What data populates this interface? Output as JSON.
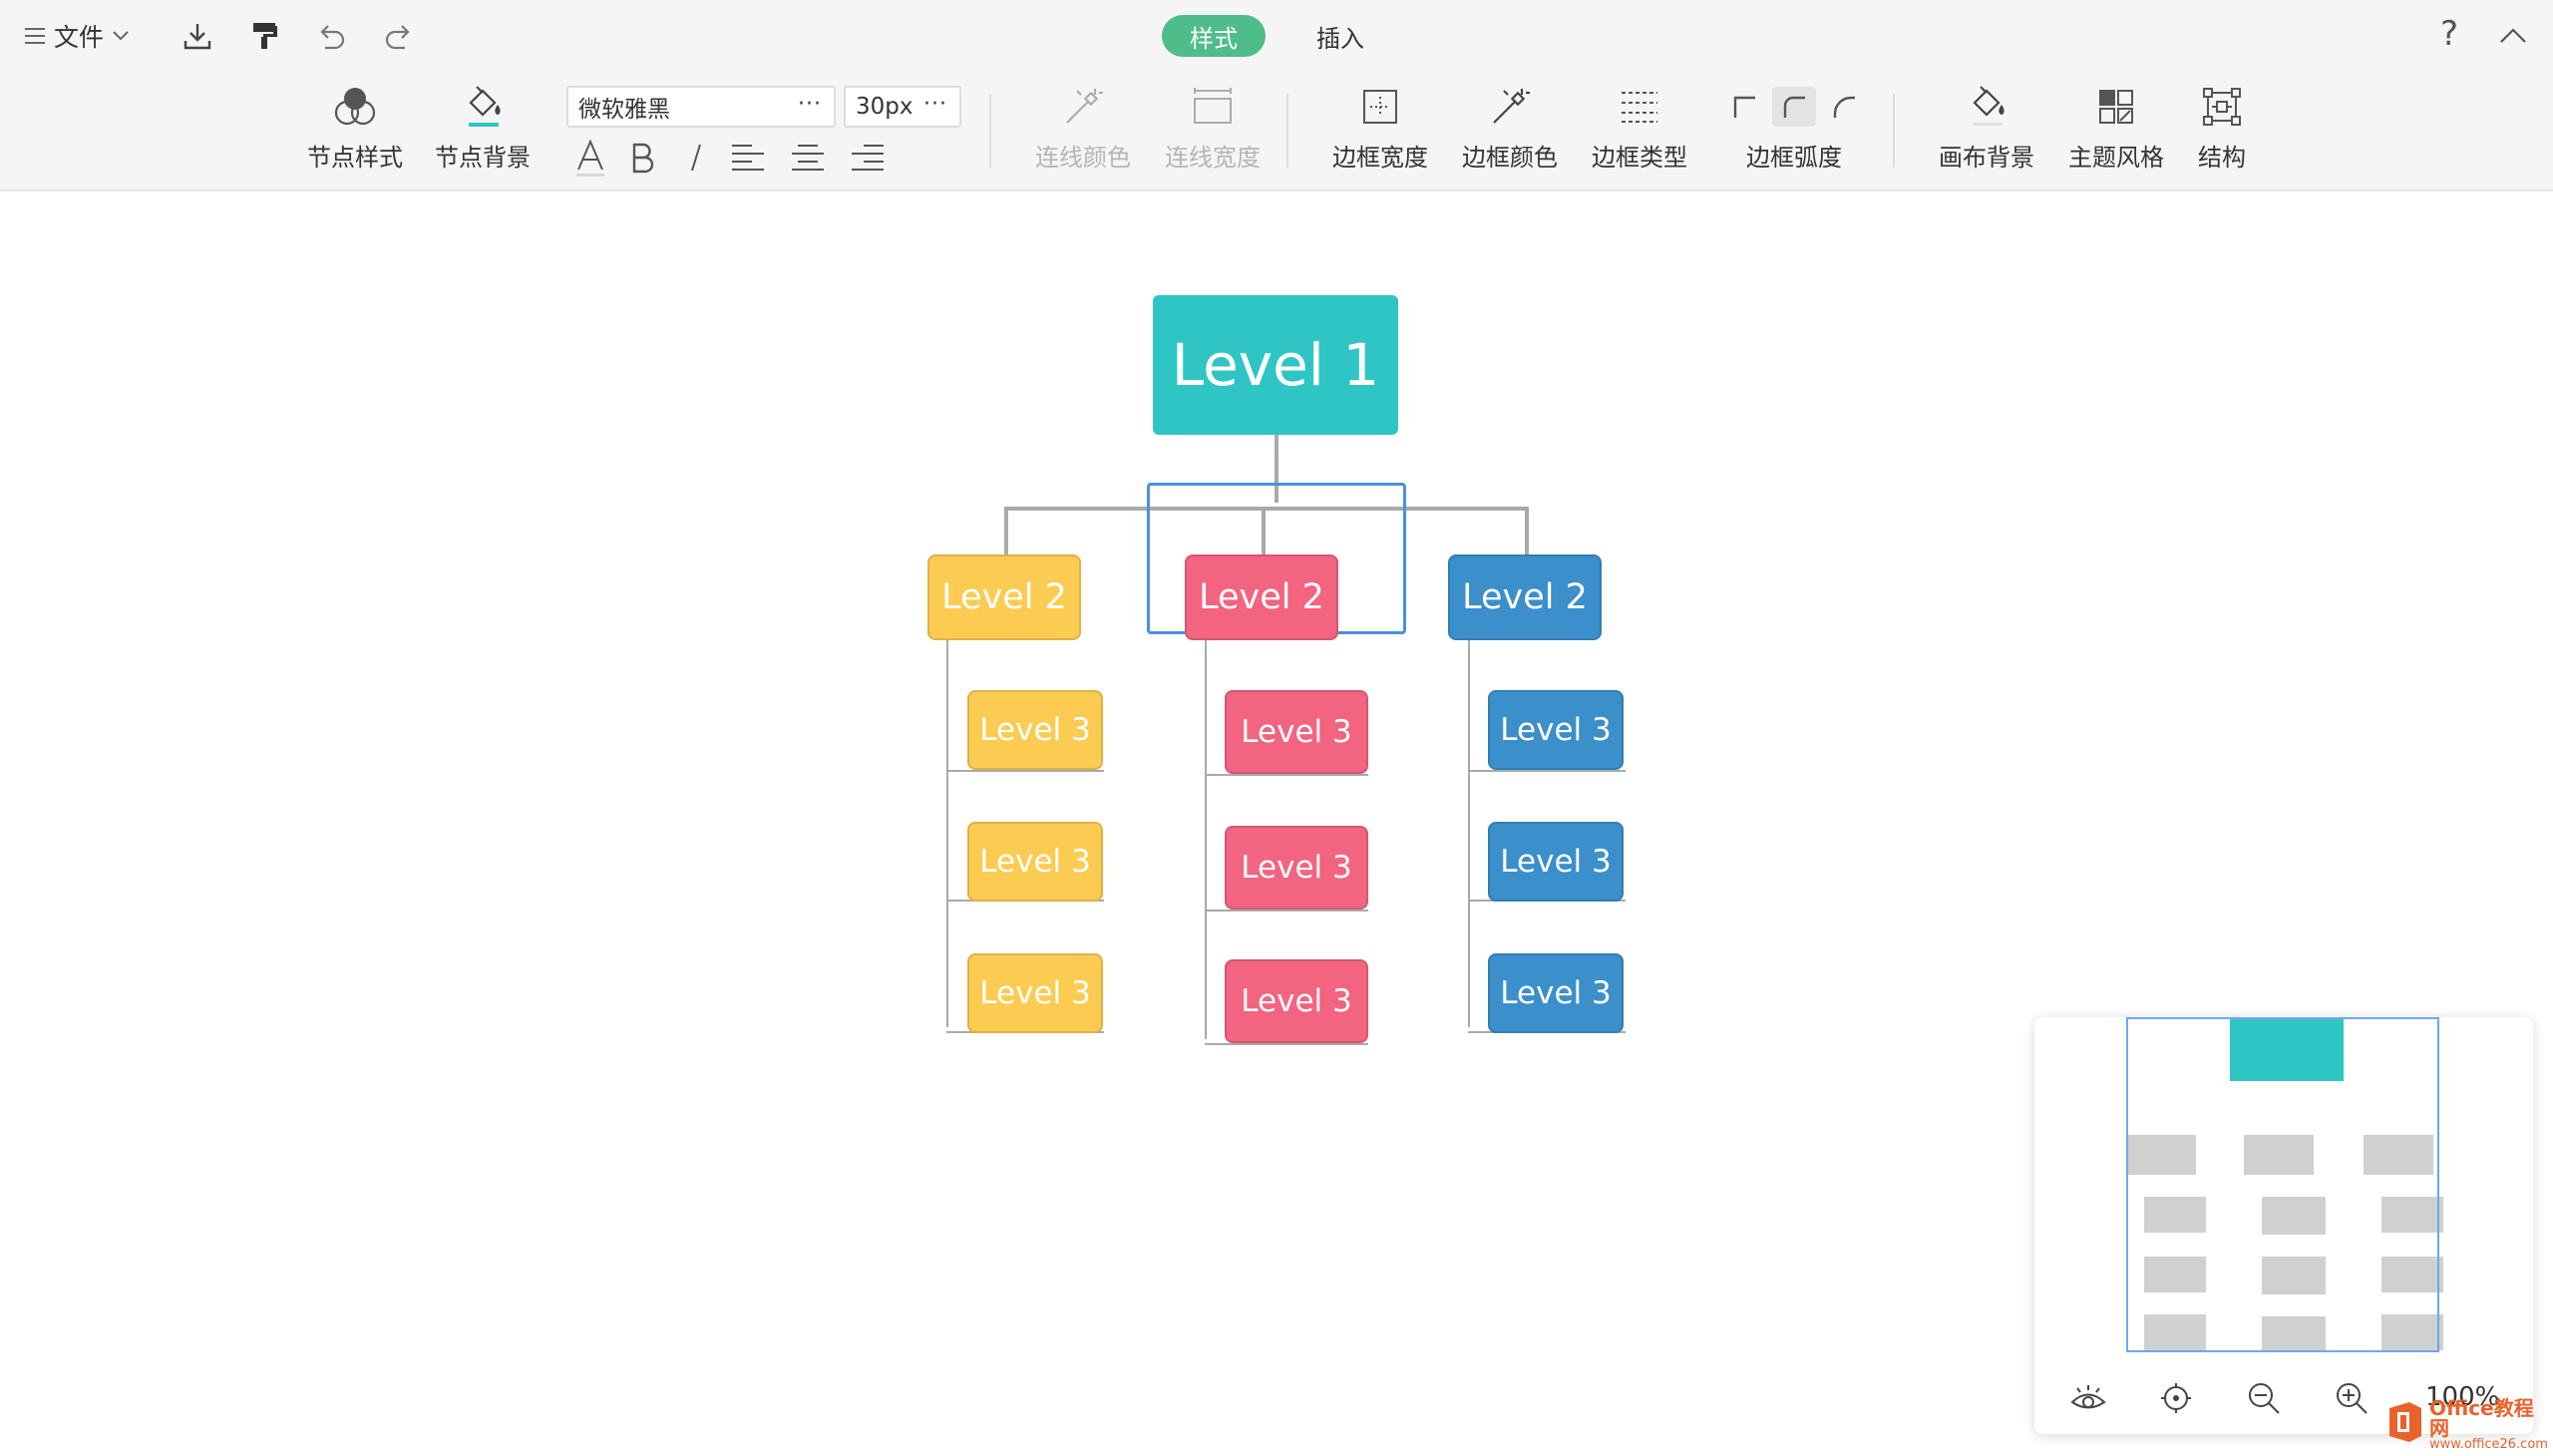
{
  "toolbar": {
    "file_label": "文件",
    "tabs": [
      {
        "label": "样式",
        "active": true
      },
      {
        "label": "插入",
        "active": false
      }
    ],
    "help_label": "?",
    "node_style_label": "节点样式",
    "node_bg_label": "节点背景",
    "font_family": "微软雅黑",
    "font_size": "30px",
    "more": "···",
    "line_color_label": "连线颜色",
    "line_width_label": "连线宽度",
    "border_width_label": "边框宽度",
    "border_color_label": "边框颜色",
    "border_type_label": "边框类型",
    "border_radius_label": "边框弧度",
    "canvas_bg_label": "画布背景",
    "theme_label": "主题风格",
    "structure_label": "结构"
  },
  "colors": {
    "accent": "#4fbd8a",
    "level1": "#2fc5c5",
    "yellow": "#fccb52",
    "pink": "#f26480",
    "blue": "#3b8fcb"
  },
  "mindmap": {
    "root": "Level 1",
    "branches": [
      {
        "label": "Level 2",
        "color": "yellow",
        "children": [
          "Level 3",
          "Level 3",
          "Level 3"
        ]
      },
      {
        "label": "Level 2",
        "color": "pink",
        "children": [
          "Level 3",
          "Level 3",
          "Level 3"
        ]
      },
      {
        "label": "Level 2",
        "color": "blue",
        "children": [
          "Level 3",
          "Level 3",
          "Level 3"
        ]
      }
    ]
  },
  "minimap": {
    "zoom": "100%"
  },
  "watermark": {
    "main": "Office教程网",
    "sub": "www.office26.com"
  }
}
